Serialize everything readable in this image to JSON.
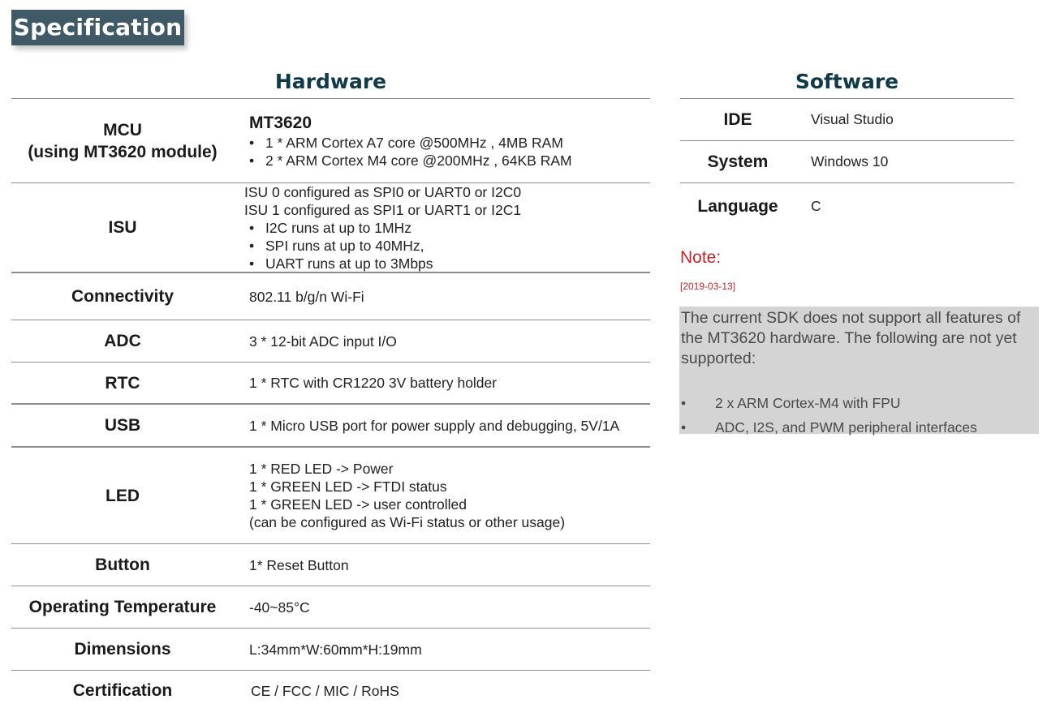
{
  "title": "Specification",
  "hardware": {
    "heading": "Hardware",
    "rows": [
      {
        "label_lines": [
          "MCU",
          "(using MT3620 module)"
        ],
        "value_title": "MT3620",
        "bullets": [
          "1 * ARM Cortex A7 core @500MHz , 4MB RAM",
          "2 * ARM Cortex M4 core @200MHz , 64KB RAM"
        ]
      },
      {
        "label": "ISU",
        "lines": [
          "ISU 0 configured as SPI0 or UART0 or I2C0",
          "ISU 1 configured as SPI1 or UART1 or I2C1"
        ],
        "bullets": [
          "I2C runs at up to 1MHz",
          "SPI runs at up to 40MHz,",
          "UART runs at up to 3Mbps"
        ]
      },
      {
        "label": "Connectivity",
        "value": "802.11 b/g/n Wi-Fi"
      },
      {
        "label": "ADC",
        "value": "3 * 12-bit ADC input I/O"
      },
      {
        "label": "RTC",
        "value": "1 * RTC with CR1220 3V battery holder"
      },
      {
        "label": "USB",
        "value": "1 * Micro USB port for power supply and debugging, 5V/1A"
      },
      {
        "label": "LED",
        "lines": [
          "1 * RED LED -> Power",
          "1 * GREEN LED -> FTDI status",
          "1 * GREEN LED -> user controlled",
          "(can be configured as Wi-Fi status or other usage)"
        ]
      },
      {
        "label": "Button",
        "value": "1* Reset Button"
      },
      {
        "label": "Operating Temperature",
        "value": "-40~85°C"
      },
      {
        "label": "Dimensions",
        "value": "L:34mm*W:60mm*H:19mm"
      },
      {
        "label": "Certification",
        "value": "CE / FCC / MIC / RoHS"
      }
    ]
  },
  "software": {
    "heading": "Software",
    "rows": [
      {
        "label": "IDE",
        "value": "Visual Studio"
      },
      {
        "label": "System",
        "value": "Windows 10"
      },
      {
        "label": "Language",
        "value": "C"
      }
    ]
  },
  "note": {
    "title": "Note:",
    "date": "[2019-03-13]",
    "text": "The current SDK does not support all features of the MT3620 hardware. The following are not yet supported:",
    "items": [
      "2 x ARM Cortex-M4 with FPU",
      "ADC, I2S, and PWM peripheral interfaces"
    ]
  },
  "bullet_char": "•"
}
